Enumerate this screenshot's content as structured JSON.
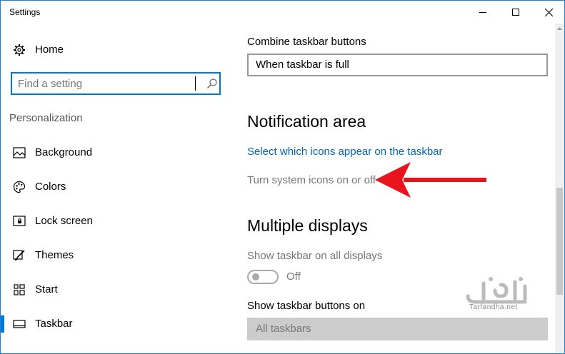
{
  "window": {
    "title": "Settings"
  },
  "sidebar": {
    "home_label": "Home",
    "search": {
      "placeholder": "Find a setting",
      "value": ""
    },
    "section_label": "Personalization",
    "items": [
      {
        "label": "Background",
        "icon": "picture-icon"
      },
      {
        "label": "Colors",
        "icon": "palette-icon"
      },
      {
        "label": "Lock screen",
        "icon": "lock-screen-icon"
      },
      {
        "label": "Themes",
        "icon": "brush-icon"
      },
      {
        "label": "Start",
        "icon": "start-grid-icon"
      },
      {
        "label": "Taskbar",
        "icon": "taskbar-icon",
        "active": true
      }
    ]
  },
  "content": {
    "combine_label": "Combine taskbar buttons",
    "combine_value": "When taskbar is full",
    "notification_heading": "Notification area",
    "select_icons_link": "Select which icons appear on the taskbar",
    "system_icons_link": "Turn system icons on or off",
    "multiple_displays_heading": "Multiple displays",
    "show_all_label": "Show taskbar on all displays",
    "show_all_toggle_state": "Off",
    "show_buttons_label": "Show taskbar buttons on",
    "show_buttons_value": "All taskbars"
  },
  "watermark": {
    "text": "Tarfandha.net"
  },
  "colors": {
    "accent": "#0078d7",
    "link": "#0067b8",
    "annotation_arrow": "#e8141c"
  }
}
